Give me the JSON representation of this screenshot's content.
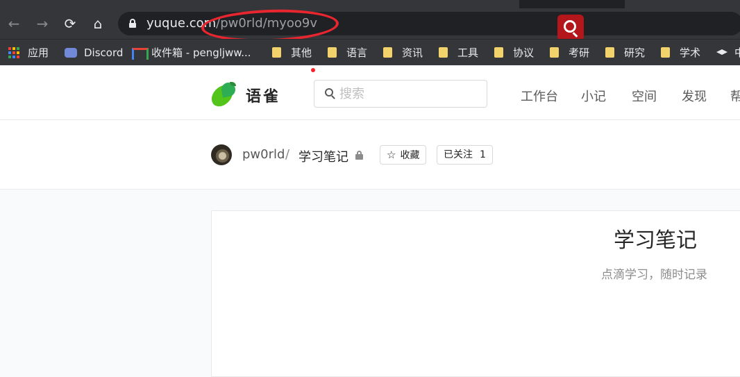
{
  "browser": {
    "url_host": "yuque.com",
    "url_path": "/pw0rld/myoo9v",
    "nav": {
      "back": "←",
      "forward": "→",
      "reload": "⟳",
      "home": "⌂"
    },
    "bookmarks": [
      {
        "label": "应用",
        "icon": "apps-grid-icon"
      },
      {
        "label": "Discord",
        "icon": "discord-icon"
      },
      {
        "label": "收件箱 - pengljww...",
        "icon": "gmail-icon"
      },
      {
        "label": "其他",
        "icon": "folder-icon"
      },
      {
        "label": "语言",
        "icon": "folder-icon"
      },
      {
        "label": "资讯",
        "icon": "folder-icon"
      },
      {
        "label": "工具",
        "icon": "folder-icon"
      },
      {
        "label": "协议",
        "icon": "folder-icon"
      },
      {
        "label": "考研",
        "icon": "folder-icon"
      },
      {
        "label": "研究",
        "icon": "folder-icon"
      },
      {
        "label": "学术",
        "icon": "folder-icon"
      },
      {
        "label": "中",
        "icon": "graduation-cap-icon"
      }
    ],
    "annotation_color": "#e8262f"
  },
  "header": {
    "brand": "语雀",
    "search_placeholder": "搜索",
    "nav": [
      "工作台",
      "小记",
      "空间",
      "发现",
      "帮"
    ]
  },
  "repo": {
    "user": "pw0rld",
    "separator": "/",
    "name": "学习笔记",
    "collect_label": "收藏",
    "follow_label": "已关注",
    "follow_count": "1"
  },
  "book": {
    "title": "学习笔记",
    "description": "点滴学习，随时记录"
  },
  "colors": {
    "chrome_bg": "#35363a",
    "omnibox_bg": "#202124",
    "brand_green": "#52c41a",
    "ext_red": "#b3161b"
  }
}
